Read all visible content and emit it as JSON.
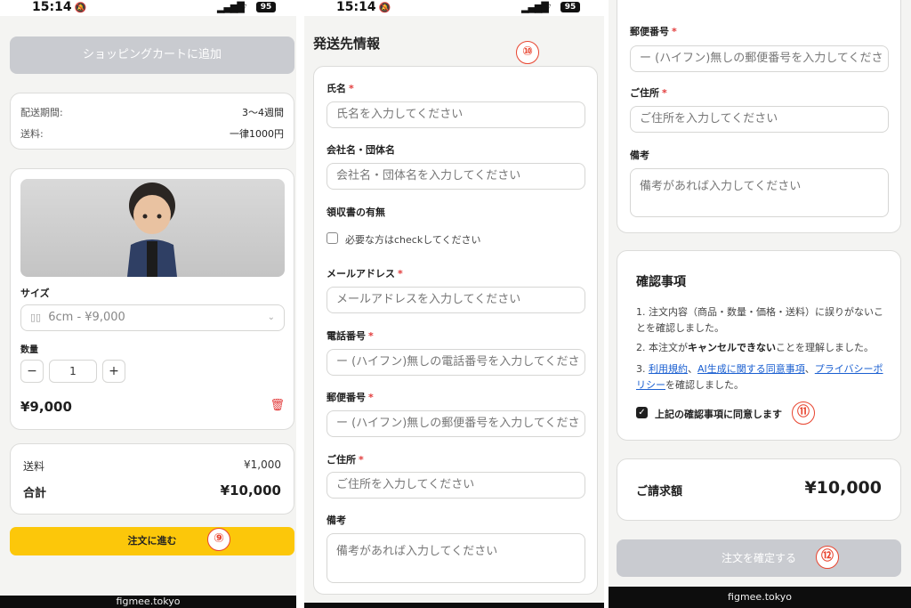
{
  "status": {
    "time": "15:14",
    "battery": "95"
  },
  "panel1": {
    "add_to_cart": "ショッピングカートに追加",
    "shipping_period_label": "配送期間:",
    "shipping_period_value": "3〜4週間",
    "shipping_fee_label": "送料:",
    "shipping_fee_value": "一律1000円",
    "size_label": "サイズ",
    "size_value": "6cm - ¥9,000",
    "qty_label": "数量",
    "qty_value": "1",
    "minus": "−",
    "plus": "+",
    "item_price": "¥9,000",
    "summary_shipping_label": "送料",
    "summary_shipping_value": "¥1,000",
    "total_label": "合計",
    "total_value": "¥10,000",
    "proceed_button": "注文に進む",
    "badge": "⑨",
    "footer": "figmee.tokyo"
  },
  "panel2": {
    "heading": "発送先情報",
    "badge": "⑩",
    "fields": {
      "name_label": "氏名",
      "name_placeholder": "氏名を入力してください",
      "company_label": "会社名・団体名",
      "company_placeholder": "会社名・団体名を入力してください",
      "receipt_label": "領収書の有無",
      "receipt_check": "必要な方はcheckしてください",
      "email_label": "メールアドレス",
      "email_placeholder": "メールアドレスを入力してください",
      "phone_label": "電話番号",
      "phone_placeholder": "ー (ハイフン)無しの電話番号を入力してくださ",
      "postal_label": "郵便番号",
      "postal_placeholder": "ー (ハイフン)無しの郵便番号を入力してくださ",
      "address_label": "ご住所",
      "address_placeholder": "ご住所を入力してください",
      "notes_label": "備考",
      "notes_placeholder": "備考があれば入力してください"
    },
    "required_mark": "*"
  },
  "panel3": {
    "postal_label": "郵便番号",
    "postal_placeholder": "ー (ハイフン)無しの郵便番号を入力してくださ",
    "address_label": "ご住所",
    "address_placeholder": "ご住所を入力してください",
    "notes_label": "備考",
    "notes_placeholder": "備考があれば入力してください",
    "required_mark": "*",
    "confirm_title": "確認事項",
    "confirm_1": "1. 注文内容（商品・数量・価格・送料）に誤りがないことを確認しました。",
    "confirm_2a": "2. 本注文が",
    "confirm_2b": "キャンセルできない",
    "confirm_2c": "ことを理解しました。",
    "confirm_3a": "3. ",
    "link_terms": "利用規約",
    "sep1": "、",
    "link_ai": "AI生成に関する同意事項",
    "sep2": "、",
    "link_privacy": "プライバシーポリシー",
    "confirm_3b": "を確認しました。",
    "agree_label": "上記の確認事項に同意します",
    "badge11": "⑪",
    "billing_label": "ご請求額",
    "billing_value": "¥10,000",
    "confirm_button": "注文を確定する",
    "badge12": "⑫",
    "footer": "figmee.tokyo"
  }
}
